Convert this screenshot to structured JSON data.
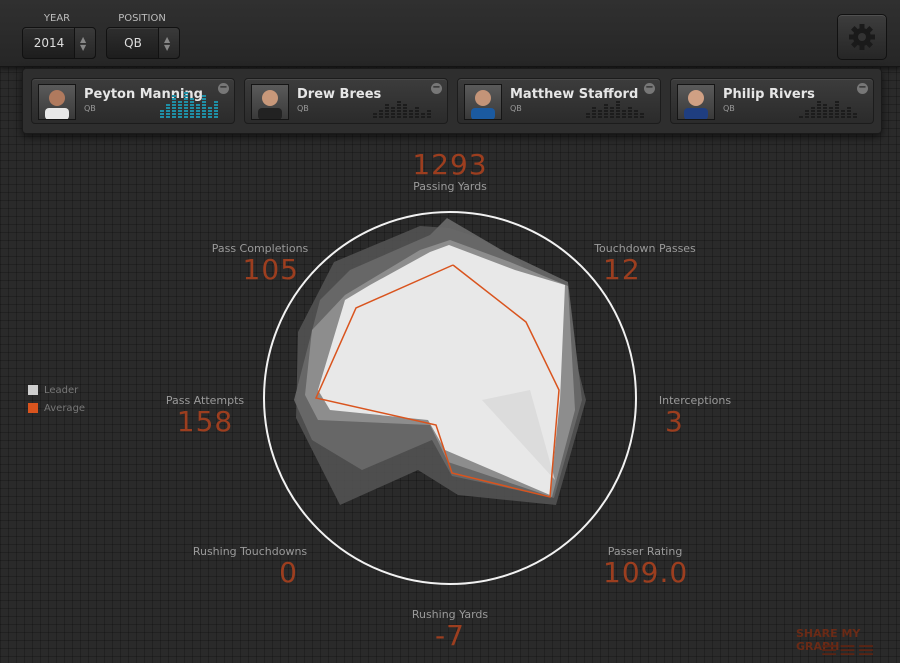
{
  "controls": {
    "year": {
      "label": "YEAR",
      "value": "2014"
    },
    "position": {
      "label": "POSITION",
      "value": "QB"
    },
    "settings_icon": "gear-icon"
  },
  "players": [
    {
      "name": "Peyton Manning",
      "position": "QB",
      "active": true,
      "bars": [
        3,
        5,
        8,
        6,
        9,
        7,
        5,
        8,
        4,
        6
      ],
      "bar_color": "#1f8fa6"
    },
    {
      "name": "Drew Brees",
      "position": "QB",
      "active": false,
      "bars": [
        2,
        3,
        5,
        4,
        6,
        5,
        3,
        4,
        2,
        3
      ],
      "bar_color": "#1c1c1c"
    },
    {
      "name": "Matthew Stafford",
      "position": "QB",
      "active": false,
      "bars": [
        2,
        4,
        3,
        5,
        4,
        6,
        3,
        4,
        3,
        2
      ],
      "bar_color": "#1c1c1c"
    },
    {
      "name": "Philip Rivers",
      "position": "QB",
      "active": false,
      "bars": [
        1,
        3,
        4,
        6,
        5,
        4,
        6,
        3,
        4,
        2
      ],
      "bar_color": "#1c1c1c"
    }
  ],
  "stats": {
    "passing_yards": {
      "label": "Passing Yards",
      "value": "1293"
    },
    "touchdown_passes": {
      "label": "Touchdown Passes",
      "value": "12"
    },
    "interceptions": {
      "label": "Interceptions",
      "value": "3"
    },
    "passer_rating": {
      "label": "Passer Rating",
      "value": "109.0"
    },
    "rushing_yards": {
      "label": "Rushing Yards",
      "value": "-7"
    },
    "rushing_touchdowns": {
      "label": "Rushing Touchdowns",
      "value": "0"
    },
    "pass_attempts": {
      "label": "Pass Attempts",
      "value": "158"
    },
    "pass_completions": {
      "label": "Pass Completions",
      "value": "105"
    }
  },
  "legend": {
    "leader": {
      "label": "Leader",
      "color": "#cfcfcf"
    },
    "average": {
      "label": "Average",
      "color": "#d9541e"
    }
  },
  "share": {
    "label": "SHARE MY GRAPH"
  },
  "colors": {
    "accent": "#9c3e1f",
    "average_line": "#d9541e",
    "active_bars": "#1f8fa6"
  }
}
